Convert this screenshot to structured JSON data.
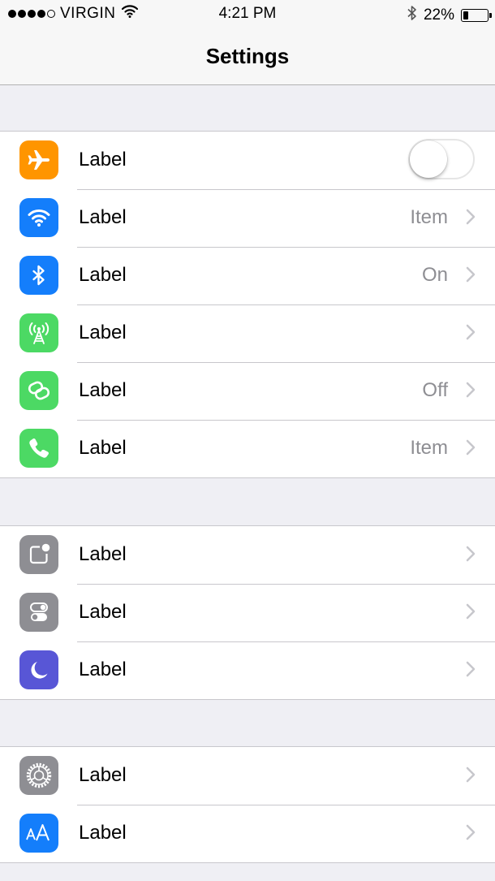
{
  "status_bar": {
    "carrier": "VIRGIN",
    "time": "4:21 PM",
    "battery": "22%",
    "battery_level": 0.22,
    "signal_bars": 4,
    "signal_total": 5
  },
  "nav": {
    "title": "Settings"
  },
  "groups": [
    {
      "rows": [
        {
          "label": "Label",
          "icon": "airplane-icon",
          "color": "#ff9500",
          "toggle": false
        },
        {
          "label": "Label",
          "icon": "wifi-icon",
          "color": "#147efb",
          "detail": "Item"
        },
        {
          "label": "Label",
          "icon": "bluetooth-icon",
          "color": "#147efb",
          "detail": "On"
        },
        {
          "label": "Label",
          "icon": "cellular-icon",
          "color": "#4cd964",
          "detail": ""
        },
        {
          "label": "Label",
          "icon": "hotspot-icon",
          "color": "#4cd964",
          "detail": "Off"
        },
        {
          "label": "Label",
          "icon": "phone-icon",
          "color": "#4cd964",
          "detail": "Item"
        }
      ]
    },
    {
      "rows": [
        {
          "label": "Label",
          "icon": "notifications-icon",
          "color": "#8e8e93"
        },
        {
          "label": "Label",
          "icon": "control-center-icon",
          "color": "#8e8e93"
        },
        {
          "label": "Label",
          "icon": "moon-icon",
          "color": "#5856d6"
        }
      ]
    },
    {
      "rows": [
        {
          "label": "Label",
          "icon": "gear-icon",
          "color": "#8e8e93"
        },
        {
          "label": "Label",
          "icon": "text-size-icon",
          "color": "#147efb"
        }
      ]
    }
  ]
}
